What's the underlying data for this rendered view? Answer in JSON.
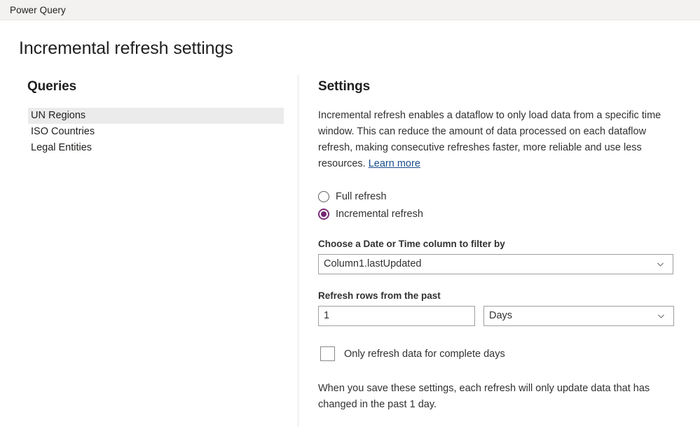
{
  "appbar": {
    "title": "Power Query"
  },
  "page": {
    "title": "Incremental refresh settings"
  },
  "queries": {
    "heading": "Queries",
    "items": [
      {
        "label": "UN Regions",
        "selected": true
      },
      {
        "label": "ISO Countries",
        "selected": false
      },
      {
        "label": "Legal Entities",
        "selected": false
      }
    ]
  },
  "settings": {
    "heading": "Settings",
    "description": "Incremental refresh enables a dataflow to only load data from a specific time window. This can reduce the amount of data processed on each dataflow refresh, making consecutive refreshes faster, more reliable and use less resources. ",
    "learn_more": "Learn more",
    "refresh_mode": {
      "options": [
        {
          "label": "Full refresh",
          "checked": false
        },
        {
          "label": "Incremental refresh",
          "checked": true
        }
      ],
      "selected": "Incremental refresh"
    },
    "date_column": {
      "label": "Choose a Date or Time column to filter by",
      "value": "Column1.lastUpdated",
      "chevron_icon": "chevron-down-icon"
    },
    "refresh_rows": {
      "label": "Refresh rows from the past",
      "amount": "1",
      "amount_placeholder": "",
      "unit": "Days",
      "unit_chevron_icon": "chevron-down-icon"
    },
    "complete_days": {
      "label": "Only refresh data for complete days",
      "checked": false
    },
    "summary": "When you save these settings, each refresh will only update data that has changed in the past 1 day."
  },
  "colors": {
    "accent": "#742774",
    "link": "#1b4d8c",
    "appbar_bg": "#f3f2f1",
    "selected_row_bg": "#ebebeb",
    "border": "#a19f9d"
  }
}
